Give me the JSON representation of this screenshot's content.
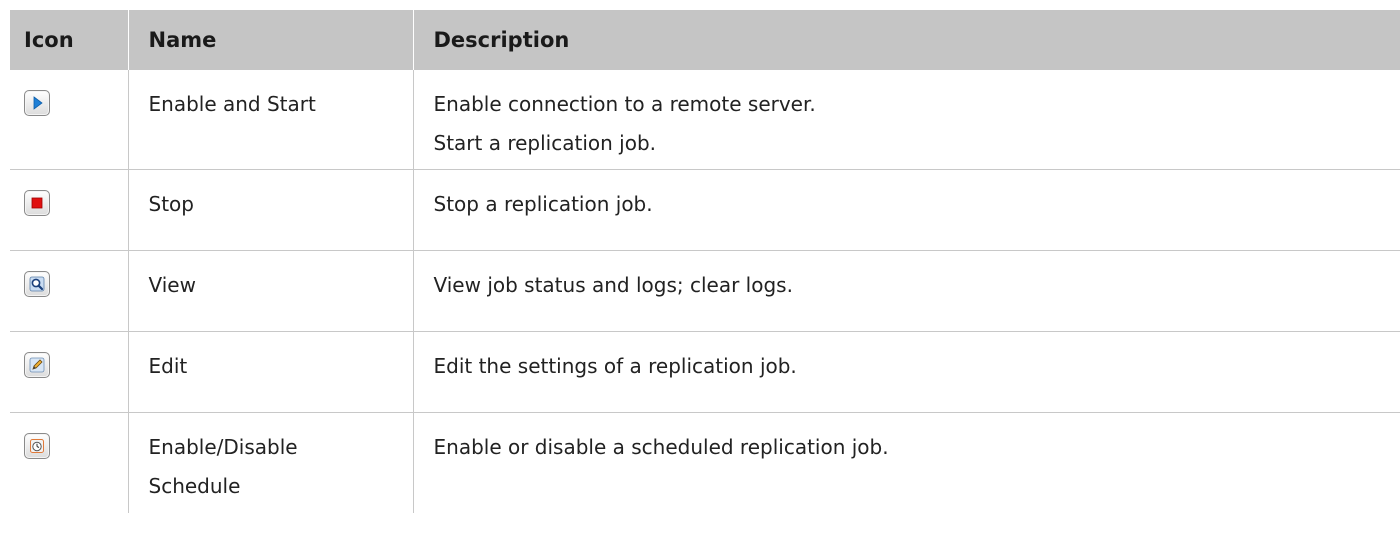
{
  "headers": {
    "icon": "Icon",
    "name": "Name",
    "description": "Description"
  },
  "rows": [
    {
      "icon": "play-icon",
      "name_lines": [
        "Enable and Start"
      ],
      "description_lines": [
        "Enable connection to a remote server.",
        "Start a replication job."
      ]
    },
    {
      "icon": "stop-icon",
      "name_lines": [
        "Stop"
      ],
      "description_lines": [
        "Stop a replication job."
      ]
    },
    {
      "icon": "magnifier-icon",
      "name_lines": [
        "View"
      ],
      "description_lines": [
        "View job status and logs; clear logs."
      ]
    },
    {
      "icon": "edit-pencil-icon",
      "name_lines": [
        "Edit"
      ],
      "description_lines": [
        "Edit the settings of a replication job."
      ]
    },
    {
      "icon": "schedule-clock-icon",
      "name_lines": [
        "Enable/Disable",
        "Schedule"
      ],
      "description_lines": [
        "Enable or disable a scheduled replication job."
      ]
    }
  ],
  "colors": {
    "header_bg": "#c5c5c5",
    "grid_line": "#c8c8c8",
    "play_blue": "#1e7fd6",
    "stop_red": "#e01010"
  }
}
